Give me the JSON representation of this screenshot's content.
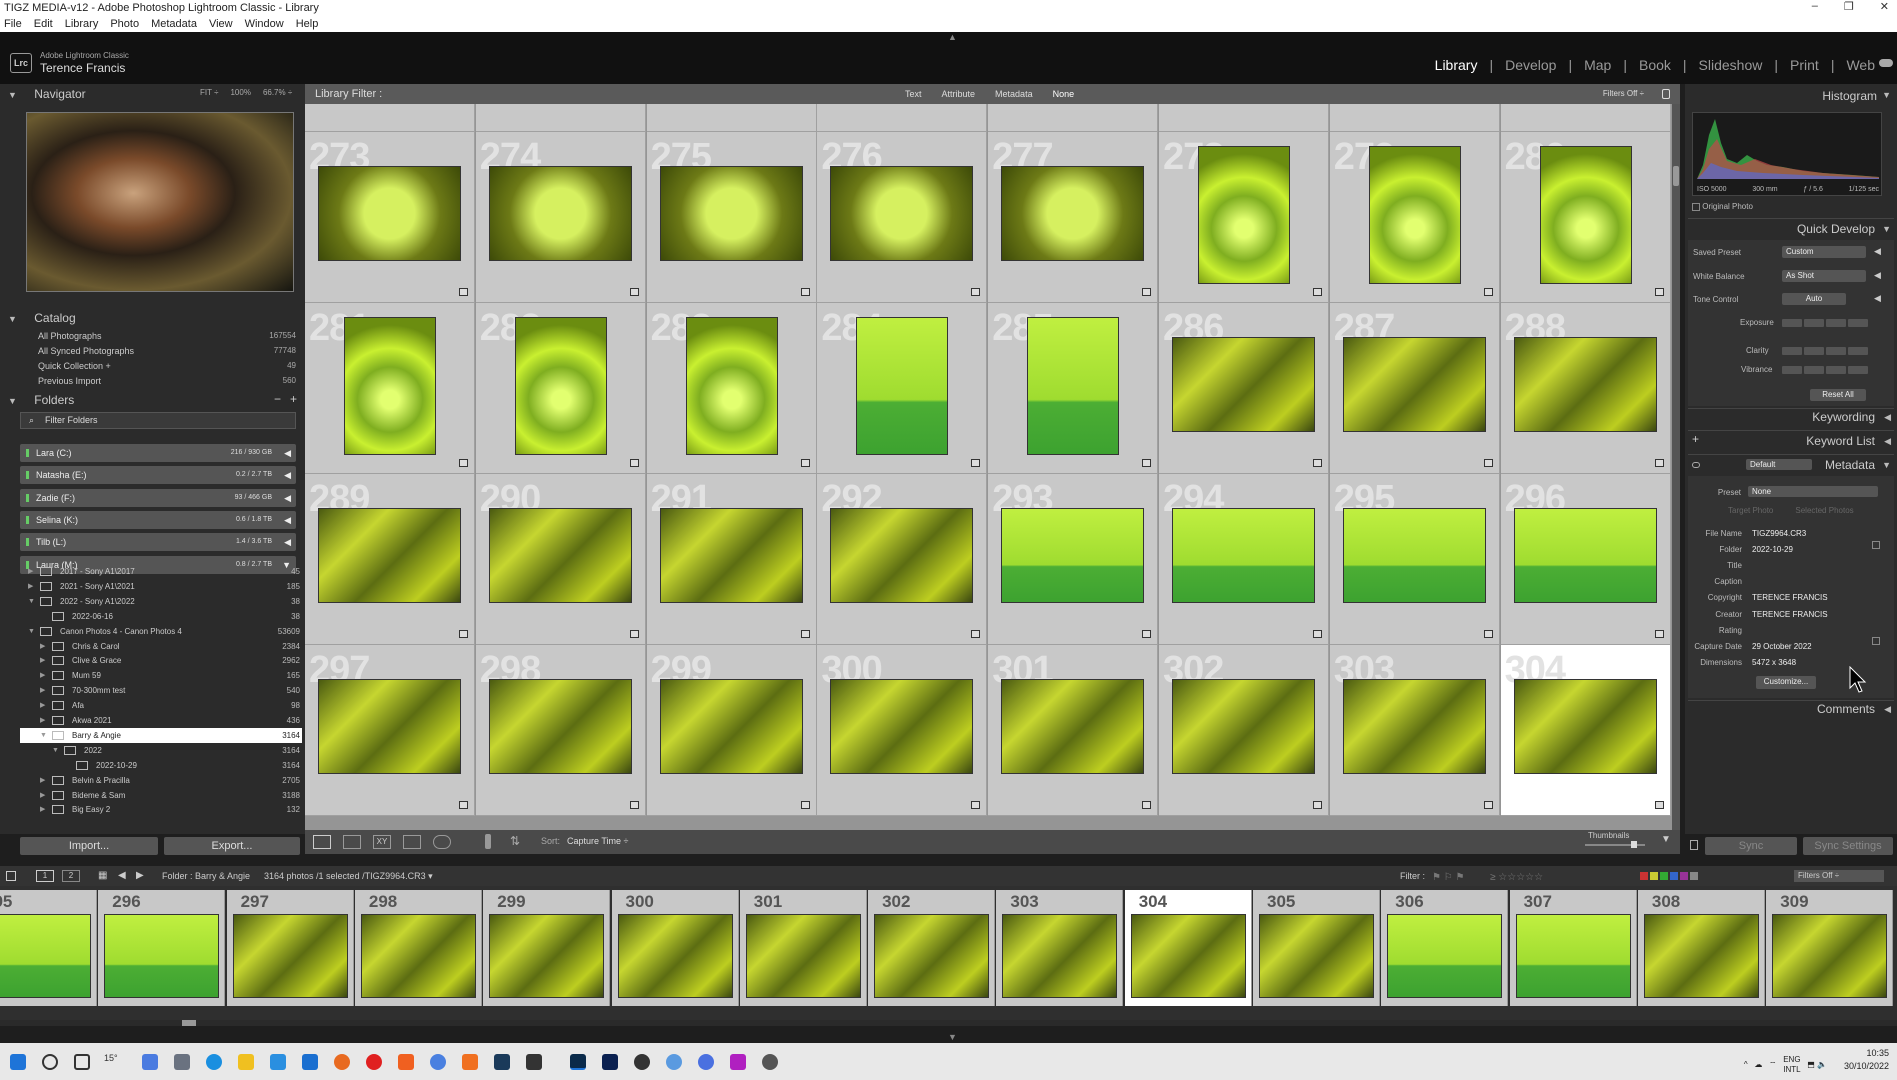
{
  "window": {
    "title": "TIGZ MEDIA-v12 - Adobe Photoshop Lightroom Classic - Library",
    "controls": [
      "–",
      "❐",
      "✕"
    ]
  },
  "menu": [
    "File",
    "Edit",
    "Library",
    "Photo",
    "Metadata",
    "View",
    "Window",
    "Help"
  ],
  "identity": {
    "logo": "Lrc",
    "app": "Adobe Lightroom Classic",
    "user": "Terence Francis"
  },
  "modules": [
    "Library",
    "Develop",
    "Map",
    "Book",
    "Slideshow",
    "Print",
    "Web"
  ],
  "navigator": {
    "title": "Navigator",
    "zoom": [
      "FIT ÷",
      "100%",
      "66.7% ÷"
    ]
  },
  "catalog": {
    "title": "Catalog",
    "items": [
      {
        "label": "All Photographs",
        "count": "167554"
      },
      {
        "label": "All Synced Photographs",
        "count": "77748"
      },
      {
        "label": "Quick Collection +",
        "count": "49"
      },
      {
        "label": "Previous Import",
        "count": "560"
      }
    ]
  },
  "folders": {
    "title": "Folders",
    "actions": [
      "−",
      "+"
    ],
    "filter_label": "Filter Folders",
    "volumes": [
      {
        "label": "Lara (C:)",
        "size": "216 / 930 GB",
        "arrow": "◀"
      },
      {
        "label": "Natasha (E:)",
        "size": "0.2 / 2.7 TB",
        "arrow": "◀"
      },
      {
        "label": "Zadie (F:)",
        "size": "93 / 466 GB",
        "arrow": "◀"
      },
      {
        "label": "Selina (K:)",
        "size": "0.6 / 1.8 TB",
        "arrow": "◀"
      },
      {
        "label": "Tilb (L:)",
        "size": "1.4 / 3.6 TB",
        "arrow": "◀"
      },
      {
        "label": "Laura (M:)",
        "size": "0.8 / 2.7 TB",
        "arrow": "▼"
      }
    ],
    "tree": [
      {
        "label": "2017 - Sony A1\\2017",
        "count": "45",
        "exp": "▶"
      },
      {
        "label": "2021 - Sony A1\\2021",
        "count": "185",
        "exp": "▶"
      },
      {
        "label": "2022 - Sony A1\\2022",
        "count": "38",
        "exp": "▼"
      },
      {
        "label": "2022-06-16",
        "count": "38",
        "exp": ""
      },
      {
        "label": "Canon Photos 4 - Canon Photos 4",
        "count": "53609",
        "exp": "▼"
      },
      {
        "label": "Chris & Carol",
        "count": "2384",
        "exp": "▶"
      },
      {
        "label": "Clive & Grace",
        "count": "2962",
        "exp": "▶"
      },
      {
        "label": "Mum 59",
        "count": "165",
        "exp": "▶"
      },
      {
        "label": "70-300mm test",
        "count": "540",
        "exp": "▶"
      },
      {
        "label": "Afa",
        "count": "98",
        "exp": "▶"
      },
      {
        "label": "Akwa 2021",
        "count": "436",
        "exp": "▶"
      },
      {
        "label": "Barry & Angie",
        "count": "3164",
        "exp": "▼"
      },
      {
        "label": "2022",
        "count": "3164",
        "exp": "▼"
      },
      {
        "label": "2022-10-29",
        "count": "3164",
        "exp": ""
      },
      {
        "label": "Belvin & Pracilla",
        "count": "2705",
        "exp": "▶"
      },
      {
        "label": "Bideme & Sam",
        "count": "3188",
        "exp": "▶"
      },
      {
        "label": "Big Easy 2",
        "count": "132",
        "exp": "▶"
      }
    ]
  },
  "left_buttons": {
    "import": "Import...",
    "export": "Export..."
  },
  "filter_bar": {
    "title": "Library Filter :",
    "options": [
      "Text",
      "Attribute",
      "Metadata",
      "None"
    ],
    "status": "Filters Off ÷"
  },
  "grid": {
    "rows": [
      [
        {
          "n": "273",
          "kind": "doc"
        },
        {
          "n": "274",
          "kind": "doc"
        },
        {
          "n": "275",
          "kind": "doc"
        },
        {
          "n": "276",
          "kind": "doc"
        },
        {
          "n": "277",
          "kind": "doc"
        },
        {
          "n": "278",
          "kind": "flw"
        },
        {
          "n": "279",
          "kind": "flw"
        },
        {
          "n": "280",
          "kind": "flw"
        }
      ],
      [
        {
          "n": "281",
          "kind": "flw"
        },
        {
          "n": "282",
          "kind": "flw"
        },
        {
          "n": "283",
          "kind": "flw"
        },
        {
          "n": "284",
          "kind": "grn"
        },
        {
          "n": "285",
          "kind": "grn"
        },
        {
          "n": "286",
          "kind": "ppl"
        },
        {
          "n": "287",
          "kind": "ppl"
        },
        {
          "n": "288",
          "kind": "ppl"
        }
      ],
      [
        {
          "n": "289",
          "kind": "ppl"
        },
        {
          "n": "290",
          "kind": "ppl"
        },
        {
          "n": "291",
          "kind": "ppl"
        },
        {
          "n": "292",
          "kind": "ppl"
        },
        {
          "n": "293",
          "kind": "grn"
        },
        {
          "n": "294",
          "kind": "grn"
        },
        {
          "n": "295",
          "kind": "grn"
        },
        {
          "n": "296",
          "kind": "grn"
        }
      ],
      [
        {
          "n": "297",
          "kind": "ppl"
        },
        {
          "n": "298",
          "kind": "ppl"
        },
        {
          "n": "299",
          "kind": "ppl"
        },
        {
          "n": "300",
          "kind": "ppl"
        },
        {
          "n": "301",
          "kind": "ppl"
        },
        {
          "n": "302",
          "kind": "ppl"
        },
        {
          "n": "303",
          "kind": "ppl"
        },
        {
          "n": "304",
          "kind": "ppl",
          "selected": true
        }
      ]
    ]
  },
  "toolbar": {
    "sort_label": "Sort:",
    "sort_value": "Capture Time ÷",
    "thumbnails_label": "Thumbnails"
  },
  "right_buttons": {
    "sync": "Sync",
    "sync_settings": "Sync Settings"
  },
  "filmstrip_bar": {
    "pages": [
      "1",
      "2"
    ],
    "source": "Folder : Barry & Angie",
    "info": "3164 photos /1 selected /TIGZ9964.CR3 ▾",
    "filter_label": "Filter :",
    "filter_status": "Filters Off ÷"
  },
  "filmstrip": [
    "295",
    "296",
    "297",
    "298",
    "299",
    "300",
    "301",
    "302",
    "303",
    "304",
    "305",
    "306",
    "307",
    "308",
    "309"
  ],
  "filmstrip_selected": "304",
  "histogram": {
    "title": "Histogram",
    "info": [
      "ISO 5000",
      "300 mm",
      "ƒ / 5.6",
      "1/125 sec"
    ],
    "original_label": "Original Photo"
  },
  "quick_develop": {
    "title": "Quick Develop",
    "saved_preset_label": "Saved Preset",
    "saved_preset_value": "Custom",
    "white_balance_label": "White Balance",
    "white_balance_value": "As Shot",
    "tone_control_label": "Tone Control",
    "auto_label": "Auto",
    "exposure_label": "Exposure",
    "clarity_label": "Clarity",
    "vibrance_label": "Vibrance",
    "reset_label": "Reset All"
  },
  "keywording": {
    "title": "Keywording"
  },
  "keyword_list": {
    "title": "Keyword List"
  },
  "metadata": {
    "title": "Metadata",
    "set_value": "Default",
    "preset_label": "Preset",
    "preset_value": "None",
    "tabs": [
      "Target Photo",
      "Selected Photos"
    ],
    "fields": [
      {
        "label": "File Name",
        "value": "TIGZ9964.CR3"
      },
      {
        "label": "Folder",
        "value": "2022-10-29"
      },
      {
        "label": "Title",
        "value": ""
      },
      {
        "label": "Caption",
        "value": ""
      },
      {
        "label": "Copyright",
        "value": "TERENCE FRANCIS"
      },
      {
        "label": "Creator",
        "value": "TERENCE FRANCIS"
      },
      {
        "label": "Rating",
        "value": ""
      },
      {
        "label": "Capture Date",
        "value": "29 October 2022"
      },
      {
        "label": "Dimensions",
        "value": "5472 x 3648"
      }
    ],
    "customize_label": "Customize..."
  },
  "comments": {
    "title": "Comments"
  },
  "taskbar": {
    "weather": "15°",
    "lang": "ENG",
    "lang2": "INTL",
    "time": "10:35",
    "date": "30/10/2022"
  },
  "colors": {
    "accent": "#ffffff",
    "panel": "#2b2b2b",
    "grid_bg": "#c8c8c8",
    "volume_green": "#66cc66"
  }
}
